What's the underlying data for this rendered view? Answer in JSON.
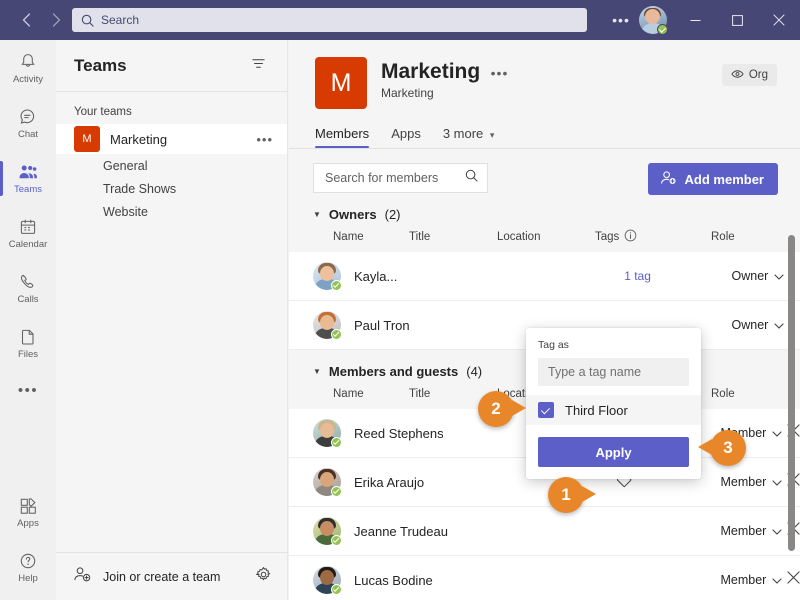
{
  "titlebar": {
    "back_icon": "chevron-left-icon",
    "forward_icon": "chevron-right-icon",
    "search_placeholder": "Search",
    "more_label": "•••",
    "minimize_label": "minimize",
    "maximize_label": "maximize",
    "close_label": "close"
  },
  "rail": {
    "items": [
      {
        "label": "Activity",
        "icon": "bell-icon",
        "active": false
      },
      {
        "label": "Chat",
        "icon": "chat-icon",
        "active": false
      },
      {
        "label": "Teams",
        "icon": "teams-icon",
        "active": true
      },
      {
        "label": "Calendar",
        "icon": "calendar-icon",
        "active": false
      },
      {
        "label": "Calls",
        "icon": "phone-icon",
        "active": false
      },
      {
        "label": "Files",
        "icon": "file-icon",
        "active": false
      }
    ],
    "more_label": "•••",
    "bottom": [
      {
        "label": "Apps",
        "icon": "apps-icon"
      },
      {
        "label": "Help",
        "icon": "help-icon"
      }
    ]
  },
  "teams_panel": {
    "title": "Teams",
    "filter_icon": "filter-icon",
    "your_teams_label": "Your teams",
    "team": {
      "initial": "M",
      "name": "Marketing",
      "more_label": "•••"
    },
    "channels": [
      "General",
      "Trade Shows",
      "Website"
    ],
    "footer": {
      "label": "Join or create a team",
      "icon": "add-person-icon",
      "settings_icon": "gear-icon"
    }
  },
  "team_header": {
    "initial": "M",
    "title": "Marketing",
    "more_label": "•••",
    "subtitle": "Marketing",
    "org_badge": "Org",
    "org_icon": "eye-icon"
  },
  "tabs": [
    {
      "label": "Members",
      "active": true
    },
    {
      "label": "Apps",
      "active": false
    },
    {
      "label": "3 more",
      "active": false,
      "chevron": "⌄"
    }
  ],
  "toolbar": {
    "search_placeholder": "Search for members",
    "search_icon": "search-icon",
    "add_member_label": "Add member",
    "add_member_icon": "add-person-icon"
  },
  "columns": {
    "name": "Name",
    "title": "Title",
    "location": "Location",
    "tags": "Tags",
    "tags_info_icon": "info-icon",
    "role": "Role"
  },
  "sections": [
    {
      "label": "Owners",
      "count": "(2)",
      "rows": [
        {
          "name": "Kayla...",
          "title": "",
          "location": "",
          "tags": "1 tag",
          "role": "Owner",
          "removable": false
        },
        {
          "name": "Paul Tron",
          "title": "",
          "location": "",
          "tags": "",
          "role": "Owner",
          "removable": false
        }
      ]
    },
    {
      "label": "Members and guests",
      "count": "(4)",
      "rows": [
        {
          "name": "Reed Stephens",
          "title": "",
          "location": "",
          "tags": "",
          "role": "Member",
          "removable": true
        },
        {
          "name": "Erika Araujo",
          "title": "",
          "location": "",
          "tags": "tag-icon",
          "role": "Member",
          "removable": true
        },
        {
          "name": "Jeanne Trudeau",
          "title": "",
          "location": "",
          "tags": "",
          "role": "Member",
          "removable": true
        },
        {
          "name": "Lucas Bodine",
          "title": "",
          "location": "",
          "tags": "",
          "role": "Member",
          "removable": true
        }
      ]
    }
  ],
  "tag_popup": {
    "label": "Tag as",
    "input_placeholder": "Type a tag name",
    "option_label": "Third Floor",
    "option_checked": true,
    "apply_label": "Apply"
  },
  "steps": [
    {
      "number": "1"
    },
    {
      "number": "2"
    },
    {
      "number": "3"
    }
  ],
  "colors": {
    "titlebar": "#464775",
    "accent": "#5b5fc7",
    "team_avatar": "#d83b01",
    "step_badge": "#e8862a",
    "presence_available": "#92c353"
  }
}
